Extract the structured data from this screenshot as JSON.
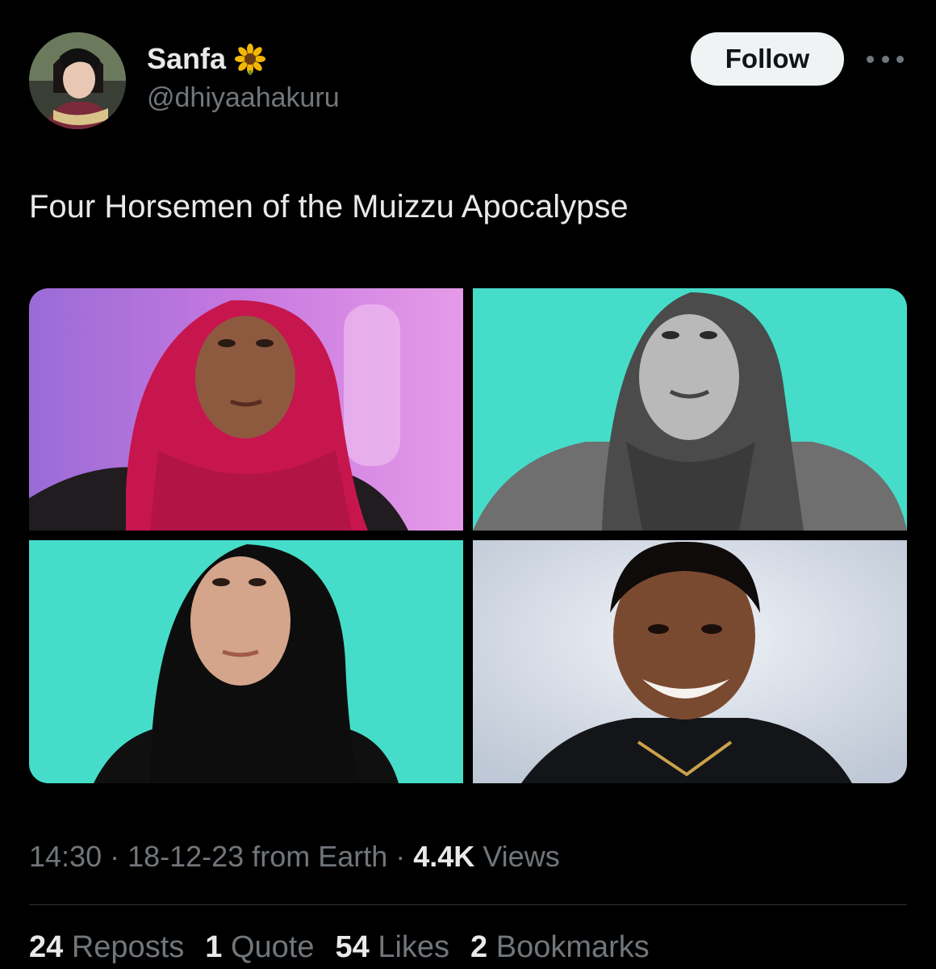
{
  "author": {
    "name": "Sanfa",
    "name_emoji": "sunflower",
    "handle": "@dhiyaahakuru"
  },
  "follow_label": "Follow",
  "more_icon": "more-icon",
  "tweet_text": "Four Horsemen of the Muizzu Apocalypse",
  "media": [
    {
      "name": "photo-1",
      "background": "#c77ae0"
    },
    {
      "name": "photo-2",
      "background": "#45ddc9"
    },
    {
      "name": "photo-3",
      "background": "#45ddc9"
    },
    {
      "name": "photo-4",
      "background": "#d7dfea"
    }
  ],
  "meta": {
    "time": "14:30",
    "sep1": " · ",
    "date": "18-12-23",
    "source": " from Earth",
    "sep2": " · ",
    "views_count": "4.4K",
    "views_label": " Views"
  },
  "stats": {
    "reposts_count": "24",
    "reposts_label": "Reposts",
    "quotes_count": "1",
    "quotes_label": "Quote",
    "likes_count": "54",
    "likes_label": "Likes",
    "bookmarks_count": "2",
    "bookmarks_label": "Bookmarks"
  },
  "colors": {
    "background": "#000000",
    "text": "#e7e9ea",
    "secondary": "#71767b",
    "follow_bg": "#eff3f4"
  }
}
